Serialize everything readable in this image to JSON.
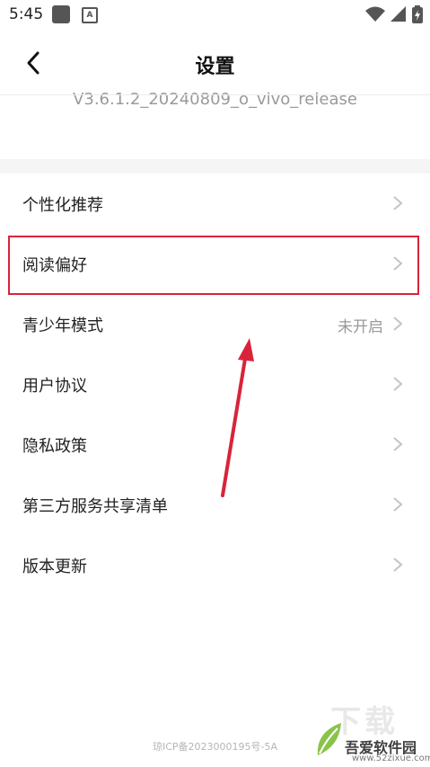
{
  "status_bar": {
    "time": "5:45"
  },
  "header": {
    "title": "设置"
  },
  "version": "V3.6.1.2_20240809_o_vivo_release",
  "settings": [
    {
      "label": "个性化推荐",
      "value": ""
    },
    {
      "label": "阅读偏好",
      "value": ""
    },
    {
      "label": "青少年模式",
      "value": "未开启"
    },
    {
      "label": "用户协议",
      "value": ""
    },
    {
      "label": "隐私政策",
      "value": ""
    },
    {
      "label": "第三方服务共享清单",
      "value": ""
    },
    {
      "label": "版本更新",
      "value": ""
    }
  ],
  "footer": {
    "icp": "琼ICP备2023000195号-5A"
  },
  "watermark": {
    "brand": "吾爱软件园",
    "url": "www.52zixue.com",
    "xz": "下载"
  },
  "colors": {
    "highlight": "#d9233a",
    "arrow": "#d9233a",
    "muted_text": "#999999"
  }
}
